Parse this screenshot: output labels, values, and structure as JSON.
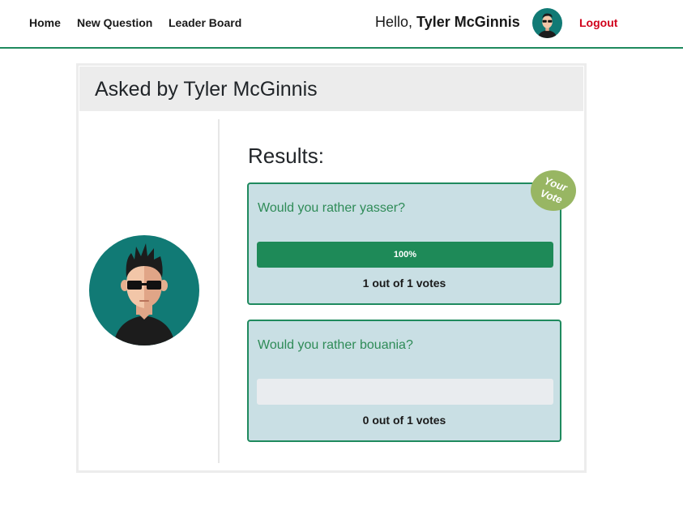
{
  "nav": {
    "links": [
      "Home",
      "New Question",
      "Leader Board"
    ],
    "greeting_prefix": "Hello, ",
    "user_name": "Tyler McGinnis",
    "logout": "Logout"
  },
  "question": {
    "header": "Asked by Tyler McGinnis",
    "results_title": "Results:",
    "badge": [
      "Your",
      "Vote"
    ],
    "options": [
      {
        "text": "Would you rather yasser?",
        "percent": 100,
        "percent_label": "100%",
        "votes_label": "1 out of 1 votes",
        "voted": true
      },
      {
        "text": "Would you rather bouania?",
        "percent": 0,
        "percent_label": "",
        "votes_label": "0 out of 1 votes",
        "voted": false
      }
    ]
  },
  "colors": {
    "accent": "#1f8a5e",
    "option_bg": "#c9dfe4",
    "logout": "#d0021b",
    "badge": "#98b663",
    "avatar_bg": "#117a75"
  }
}
